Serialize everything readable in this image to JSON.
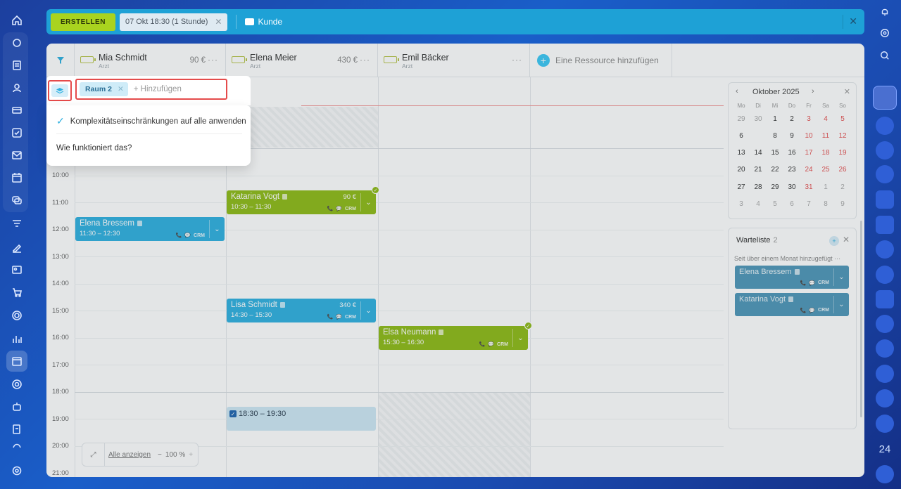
{
  "topbar": {
    "create_label": "ERSTELLEN",
    "date_chip": "07 Okt 18:30 (1 Stunde)",
    "customer_label": "Kunde"
  },
  "resources": [
    {
      "name": "Mia Schmidt",
      "role": "Arzt",
      "price": "90 €"
    },
    {
      "name": "Elena Meier",
      "role": "Arzt",
      "price": "430 €"
    },
    {
      "name": "Emil Bäcker",
      "role": "Arzt",
      "price": ""
    }
  ],
  "add_resource_label": "Eine Ressource hinzufügen",
  "time_labels": [
    "10:00",
    "11:00",
    "12:00",
    "13:00",
    "14:00",
    "15:00",
    "16:00",
    "17:00",
    "18:00",
    "19:00",
    "20:00",
    "21:00"
  ],
  "events": [
    {
      "name": "Katarina Vogt",
      "time": "10:30 – 11:30",
      "price": "90 €",
      "crm": "CRM"
    },
    {
      "name": "Elena Bressem",
      "time": "11:30 – 12:30",
      "price": "",
      "crm": "CRM"
    },
    {
      "name": "Lisa Schmidt",
      "time": "14:30 – 15:30",
      "price": "340 €",
      "crm": "CRM"
    },
    {
      "name": "Elsa Neumann",
      "time": "15:30 – 16:30",
      "price": "",
      "crm": "CRM"
    }
  ],
  "selected_slot": "18:30 – 19:30",
  "zoom": {
    "show_all": "Alle anzeigen",
    "level": "100 %",
    "minus": "−",
    "plus": "+"
  },
  "calendar": {
    "month": "Oktober 2025",
    "weekdays": [
      "Mo",
      "Di",
      "Mi",
      "Do",
      "Fr",
      "Sa",
      "So"
    ],
    "weeks": [
      [
        "29",
        "30",
        "1",
        "2",
        "3",
        "4",
        "5"
      ],
      [
        "6",
        "7",
        "8",
        "9",
        "10",
        "11",
        "12"
      ],
      [
        "13",
        "14",
        "15",
        "16",
        "17",
        "18",
        "19"
      ],
      [
        "20",
        "21",
        "22",
        "23",
        "24",
        "25",
        "26"
      ],
      [
        "27",
        "28",
        "29",
        "30",
        "31",
        "1",
        "2"
      ],
      [
        "3",
        "4",
        "5",
        "6",
        "7",
        "8",
        "9"
      ]
    ]
  },
  "waitlist": {
    "title": "Warteliste",
    "count": "2",
    "subtitle": "Seit über einem Monat hinzugefügt",
    "items": [
      {
        "name": "Elena Bressem",
        "crm": "CRM"
      },
      {
        "name": "Katarina Vogt",
        "crm": "CRM"
      }
    ]
  },
  "popup": {
    "tag": "Raum 2",
    "add_label": "+ Hinzufügen",
    "option": "Komplexitätseinschränkungen auf alle anwenden",
    "help": "Wie funktioniert das?"
  },
  "right_sidebar": {
    "badge_24": "24"
  },
  "colors": {
    "accent_blue": "#2fb0e0",
    "accent_green": "#8fbb17",
    "create_button": "#a9d31f",
    "highlight_red": "#e54b4b"
  }
}
